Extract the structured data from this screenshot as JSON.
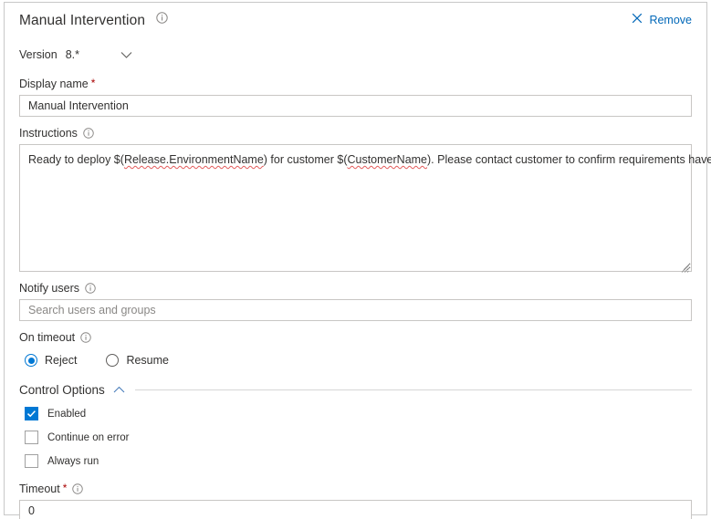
{
  "colors": {
    "accent": "#0078d4",
    "link": "#0067b8",
    "required_star": "#a80000",
    "text": "#323130",
    "placeholder": "#8a8886",
    "border": "#c8c6c4",
    "spellcheck_underline": "#e35b5b"
  },
  "header": {
    "title": "Manual Intervention",
    "info_icon": "info-icon",
    "remove_label": "Remove",
    "remove_icon": "close-x-icon"
  },
  "version": {
    "label": "Version",
    "value": "8.*",
    "caret_icon": "chevron-down-icon"
  },
  "display_name": {
    "label": "Display name",
    "required_marker": "*",
    "value": "Manual Intervention"
  },
  "instructions": {
    "label": "Instructions",
    "info_icon": "info-icon",
    "value": "Ready to deploy $(Release.EnvironmentName) for customer $(CustomerName). Please contact customer to confirm requirements have been met.",
    "segments": [
      {
        "text": "Ready to deploy $(",
        "spellcheck_error": false
      },
      {
        "text": "Release.EnvironmentName",
        "spellcheck_error": true
      },
      {
        "text": ") for customer $(",
        "spellcheck_error": false
      },
      {
        "text": "CustomerName",
        "spellcheck_error": true
      },
      {
        "text": "). Please contact customer to confirm requirements have been met.",
        "spellcheck_error": false
      }
    ],
    "resize_handle": "resize-grip-icon"
  },
  "notify_users": {
    "label": "Notify users",
    "info_icon": "info-icon",
    "value": "",
    "placeholder": "Search users and groups"
  },
  "on_timeout": {
    "label": "On timeout",
    "info_icon": "info-icon",
    "selected": "Reject",
    "options": [
      {
        "label": "Reject",
        "selected": true
      },
      {
        "label": "Resume",
        "selected": false
      }
    ]
  },
  "control_options": {
    "title": "Control Options",
    "expanded": true,
    "caret_icon": "chevron-up-icon",
    "checkboxes": [
      {
        "label": "Enabled",
        "checked": true
      },
      {
        "label": "Continue on error",
        "checked": false
      },
      {
        "label": "Always run",
        "checked": false
      }
    ]
  },
  "timeout": {
    "label": "Timeout",
    "required_marker": "*",
    "info_icon": "info-icon",
    "value": "0"
  }
}
